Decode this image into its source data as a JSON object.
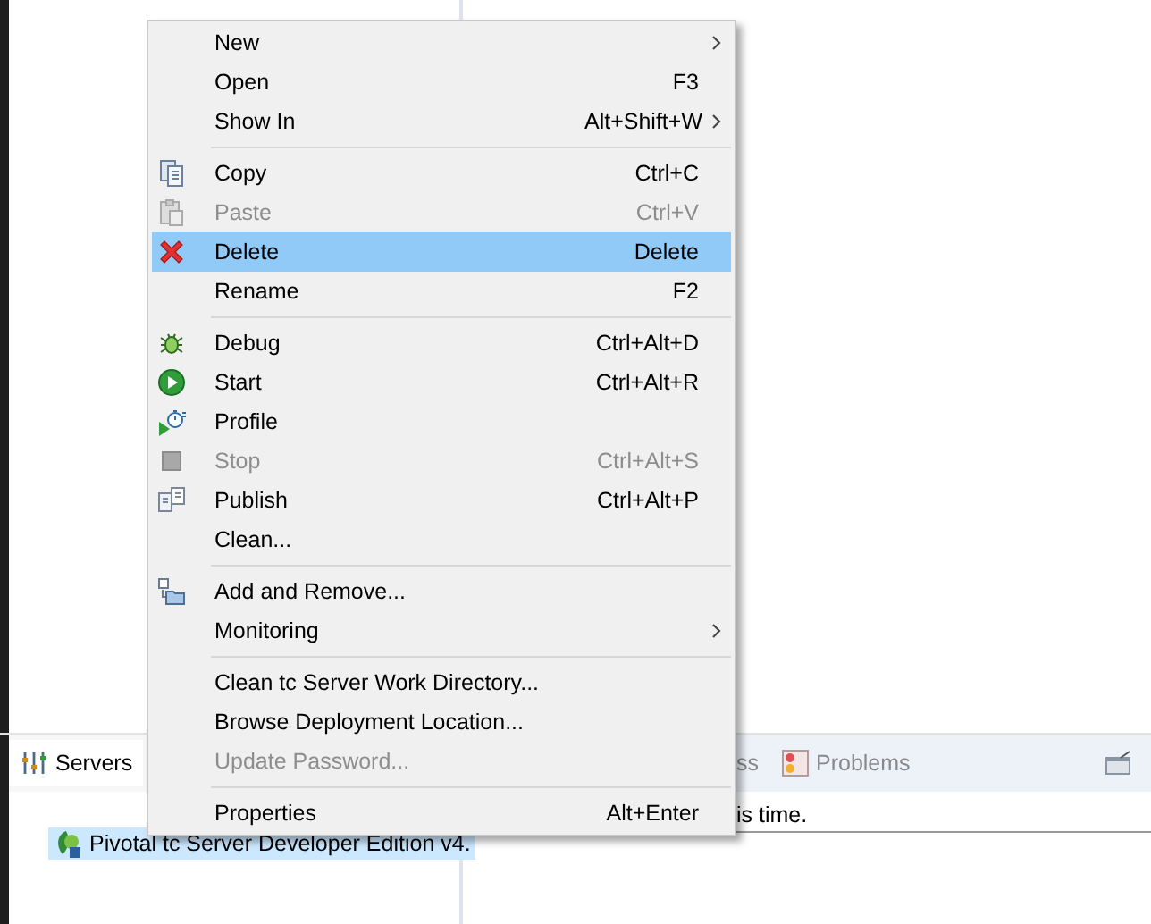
{
  "servers_view": {
    "tab": {
      "label": "Servers",
      "selected": true
    },
    "tree": [
      {
        "label": "Pivotal tc Server Developer Edition v4.",
        "selected": true
      }
    ]
  },
  "console_view": {
    "tabs": [
      {
        "label": "ss",
        "selected": false
      },
      {
        "label": "Problems",
        "selected": false
      }
    ],
    "message": "is time."
  },
  "menu": {
    "items": [
      {
        "kind": "item",
        "label": "New",
        "submenu": true,
        "disabled": false,
        "selected": false
      },
      {
        "kind": "item",
        "label": "Open",
        "shortcut": "F3",
        "submenu": false,
        "disabled": false,
        "selected": false
      },
      {
        "kind": "item",
        "label": "Show In",
        "shortcut": "Alt+Shift+W",
        "submenu": true,
        "disabled": false,
        "selected": false
      },
      {
        "kind": "separator"
      },
      {
        "kind": "item",
        "label": "Copy",
        "shortcut": "Ctrl+C",
        "submenu": false,
        "disabled": false,
        "selected": false
      },
      {
        "kind": "item",
        "label": "Paste",
        "shortcut": "Ctrl+V",
        "submenu": false,
        "disabled": true,
        "selected": false
      },
      {
        "kind": "item",
        "label": "Delete",
        "shortcut": "Delete",
        "submenu": false,
        "disabled": false,
        "selected": true
      },
      {
        "kind": "item",
        "label": "Rename",
        "shortcut": "F2",
        "submenu": false,
        "disabled": false,
        "selected": false
      },
      {
        "kind": "separator"
      },
      {
        "kind": "item",
        "label": "Debug",
        "shortcut": "Ctrl+Alt+D",
        "submenu": false,
        "disabled": false,
        "selected": false
      },
      {
        "kind": "item",
        "label": "Start",
        "shortcut": "Ctrl+Alt+R",
        "submenu": false,
        "disabled": false,
        "selected": false
      },
      {
        "kind": "item",
        "label": "Profile",
        "submenu": false,
        "disabled": false,
        "selected": false
      },
      {
        "kind": "item",
        "label": "Stop",
        "shortcut": "Ctrl+Alt+S",
        "submenu": false,
        "disabled": true,
        "selected": false
      },
      {
        "kind": "item",
        "label": "Publish",
        "shortcut": "Ctrl+Alt+P",
        "submenu": false,
        "disabled": false,
        "selected": false
      },
      {
        "kind": "item",
        "label": "Clean...",
        "submenu": false,
        "disabled": false,
        "selected": false
      },
      {
        "kind": "separator"
      },
      {
        "kind": "item",
        "label": "Add and Remove...",
        "submenu": false,
        "disabled": false,
        "selected": false
      },
      {
        "kind": "item",
        "label": "Monitoring",
        "submenu": true,
        "disabled": false,
        "selected": false
      },
      {
        "kind": "separator"
      },
      {
        "kind": "item",
        "label": "Clean tc Server Work Directory...",
        "submenu": false,
        "disabled": false,
        "selected": false
      },
      {
        "kind": "item",
        "label": "Browse Deployment Location...",
        "submenu": false,
        "disabled": false,
        "selected": false
      },
      {
        "kind": "item",
        "label": "Update Password...",
        "submenu": false,
        "disabled": true,
        "selected": false
      },
      {
        "kind": "separator"
      },
      {
        "kind": "item",
        "label": "Properties",
        "shortcut": "Alt+Enter",
        "submenu": false,
        "disabled": false,
        "selected": false
      }
    ]
  }
}
